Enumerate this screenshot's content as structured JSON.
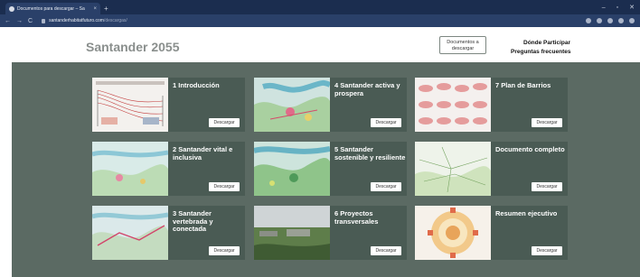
{
  "browser": {
    "tab_title": "Documentos para descargar – Sa",
    "tab_close": "×",
    "new_tab": "+",
    "url_host": "santanderhabitatfuturo.com",
    "url_path": "/descargas/",
    "win_min": "–",
    "win_max": "▫",
    "win_close": "✕",
    "back": "←",
    "forward": "→",
    "reload": "C"
  },
  "header": {
    "brand": "Santander 2055",
    "docs_button": "Documentos a descargar",
    "link_participar": "Dónde Participar",
    "link_faq": "Preguntas frecuentes"
  },
  "cards": [
    {
      "title": "1 Introducción",
      "button": "Descargar"
    },
    {
      "title": "4 Santander activa y prospera",
      "button": "Descargar"
    },
    {
      "title": "7 Plan de Barrios",
      "button": "Descargar"
    },
    {
      "title": "2 Santander vital e inclusiva",
      "button": "Descargar"
    },
    {
      "title": "5 Santander sostenible y resiliente",
      "button": "Descargar"
    },
    {
      "title": "Documento completo",
      "button": "Descargar"
    },
    {
      "title": "3 Santander vertebrada y conectada",
      "button": "Descargar"
    },
    {
      "title": "6 Proyectos transversales",
      "button": "Descargar"
    },
    {
      "title": "Resumen ejecutivo",
      "button": "Descargar"
    }
  ]
}
